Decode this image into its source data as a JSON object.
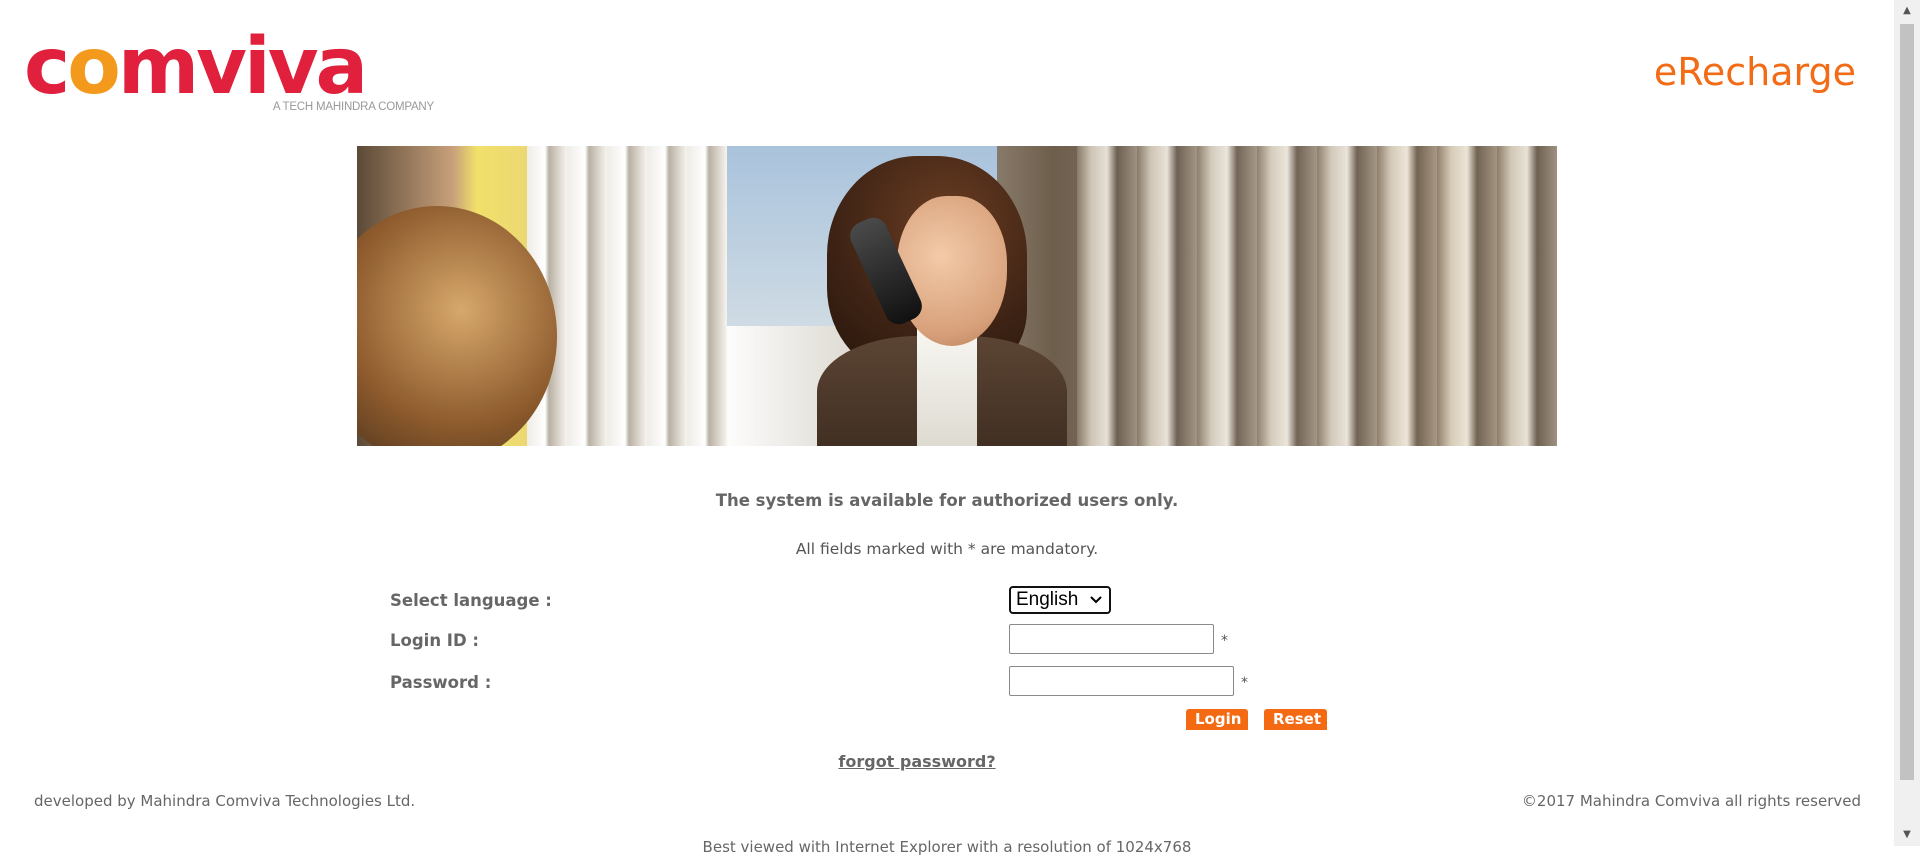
{
  "header": {
    "logo_word_start": "c",
    "logo_word_o": "o",
    "logo_word_end": "mviva",
    "logo_tagline": "A TECH MAHINDRA COMPANY",
    "app_title": "eRecharge"
  },
  "banner": {
    "description_icon": "woman-on-phone-photo"
  },
  "form": {
    "notice": "The system is available for authorized users only.",
    "mandatory_note": "All fields marked with * are mandatory.",
    "language_label": "Select language :",
    "language_selected": "English",
    "login_label": "Login ID :",
    "login_value": "",
    "password_label": "Password :",
    "password_value": "",
    "required_marker": "*",
    "login_button": "Login",
    "reset_button": "Reset",
    "forgot_link": "forgot password?"
  },
  "footer": {
    "developer": "developed by Mahindra Comviva Technologies Ltd.",
    "copyright": "©2017 Mahindra Comviva all rights reserved",
    "best_viewed": "Best viewed with Internet Explorer with a resolution of 1024x768"
  },
  "colors": {
    "brand_red": "#e0203c",
    "brand_orange": "#f46a12",
    "logo_orange": "#f39a1d"
  }
}
